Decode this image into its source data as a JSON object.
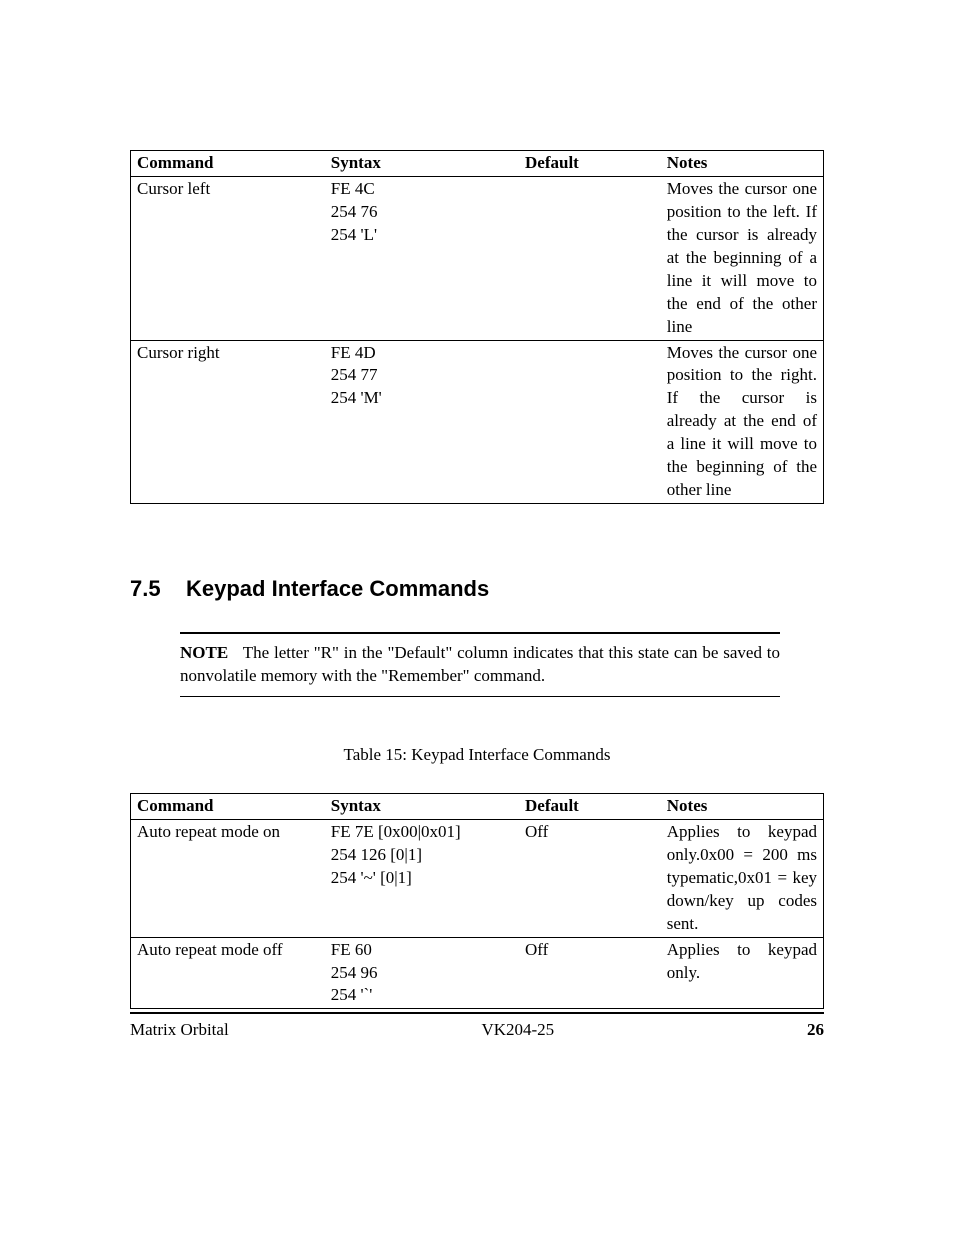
{
  "table1": {
    "headers": [
      "Command",
      "Syntax",
      "Default",
      "Notes"
    ],
    "rows": [
      {
        "command": "Cursor left",
        "syntax": "FE 4C\n254 76\n254 'L'",
        "default": "",
        "notes": "Moves the cursor one position to the left. If the cursor is already at the beginning of a line it will move to the end of the other line"
      },
      {
        "command": "Cursor right",
        "syntax": "FE 4D\n254 77\n254 'M'",
        "default": "",
        "notes": "Moves the cursor one position to the right. If the cursor is already at the end of a line it will move to the beginning of the other line"
      }
    ]
  },
  "section": {
    "number": "7.5",
    "title": "Keypad Interface Commands"
  },
  "note": {
    "label": "NOTE",
    "text": "The letter \"R\" in the \"Default\" column indicates that this state can be saved to nonvolatile memory with the \"Remember\" command."
  },
  "table2_caption": "Table 15: Keypad Interface Commands",
  "table2": {
    "headers": [
      "Command",
      "Syntax",
      "Default",
      "Notes"
    ],
    "rows": [
      {
        "command": "Auto repeat mode on",
        "syntax": "FE 7E [0x00|0x01]\n254 126 [0|1]\n254 '~' [0|1]",
        "default": "Off",
        "notes": "Applies to keypad only.0x00 = 200 ms typematic,0x01 = key down/key up codes sent."
      },
      {
        "command": "Auto repeat mode off",
        "syntax": "FE 60\n254 96\n254 '`'",
        "default": "Off",
        "notes": "Applies to keypad only."
      }
    ]
  },
  "footer": {
    "left": "Matrix Orbital",
    "center": "VK204-25",
    "right": "26"
  }
}
